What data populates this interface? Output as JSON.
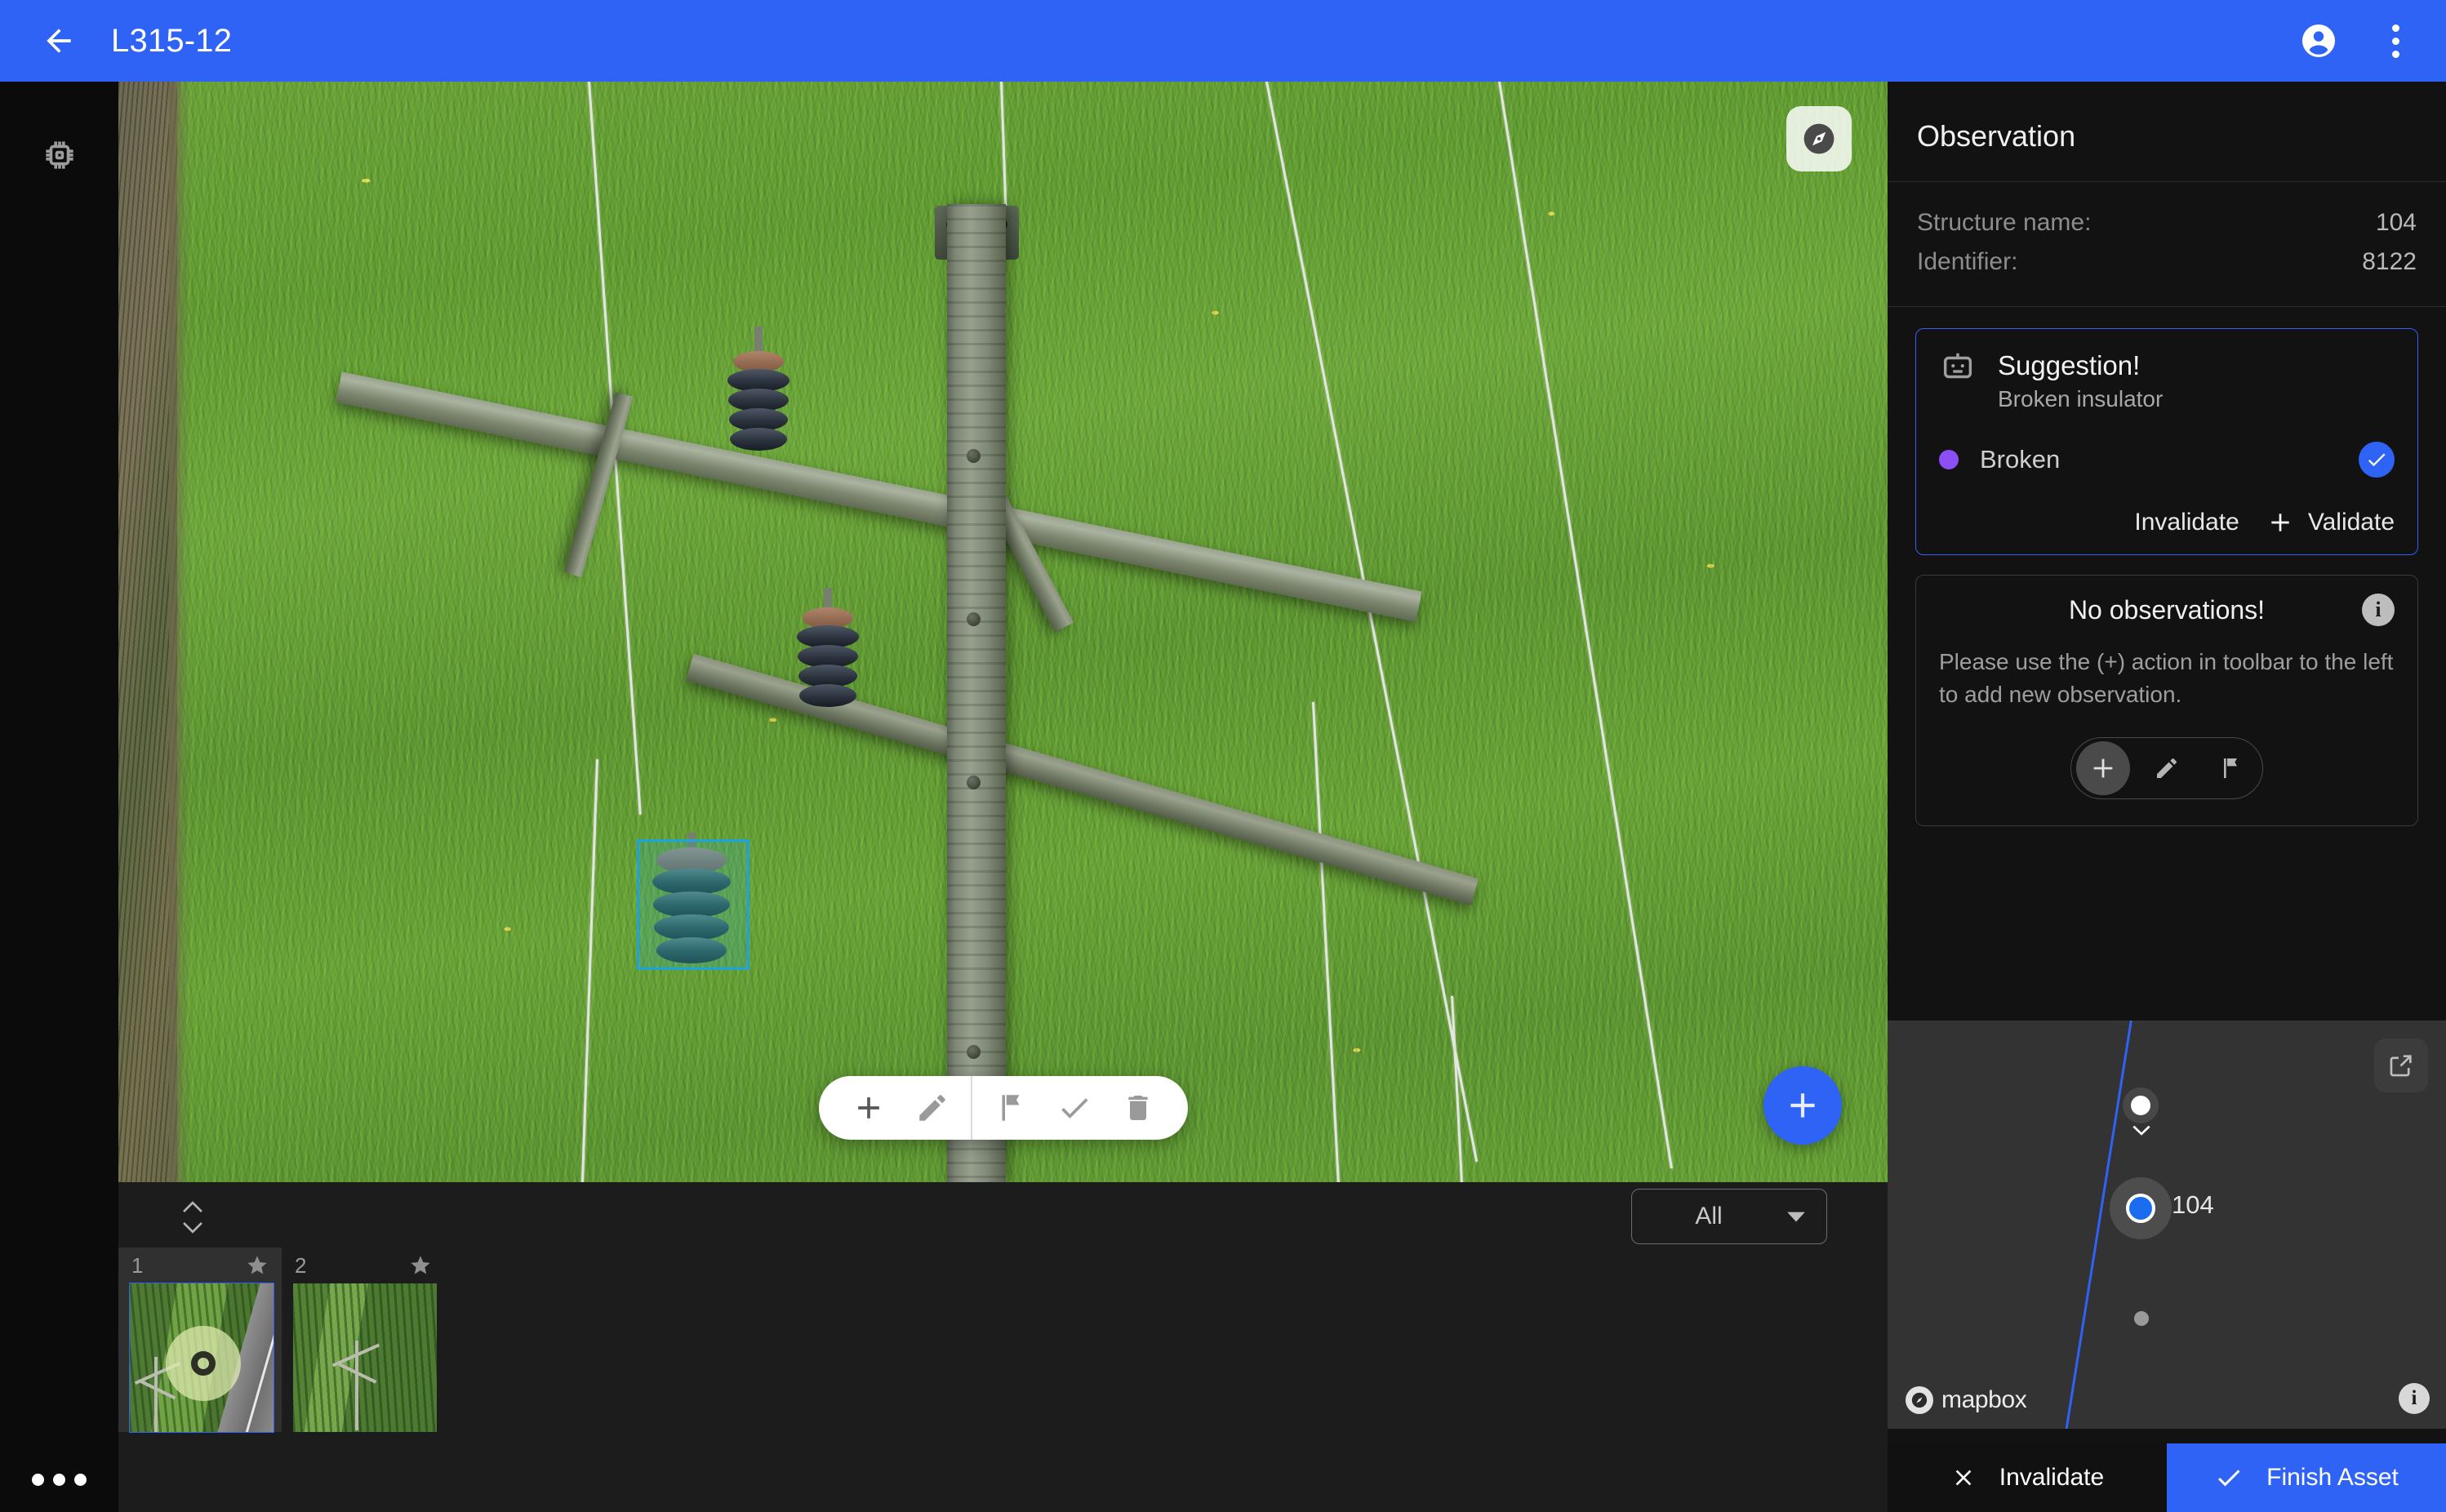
{
  "header": {
    "title": "L315-12",
    "back_icon": "arrow-back-icon",
    "account_icon": "account-circle-icon",
    "overflow_icon": "more-vert-icon"
  },
  "left_rail": {
    "chip_icon": "chip-icon",
    "more_icon": "more-horiz-icon"
  },
  "viewer": {
    "compass_icon": "explore-compass-icon",
    "bbox_color": "#1fa3dd",
    "fab": {
      "label": "+",
      "icon": "plus-icon",
      "color": "#2f63f5"
    },
    "toolbar": [
      {
        "name": "add",
        "icon": "plus-icon"
      },
      {
        "name": "edit",
        "icon": "pencil-icon"
      },
      {
        "name": "flag",
        "icon": "flag-icon"
      },
      {
        "name": "approve",
        "icon": "check-icon"
      },
      {
        "name": "delete",
        "icon": "trash-icon"
      }
    ]
  },
  "filmstrip": {
    "sort_icon": "sort-updown-icon",
    "filter": {
      "value": "All",
      "caret_icon": "chevron-down-icon"
    },
    "thumbs": [
      {
        "index": "1",
        "star_icon": "star-icon",
        "selected": true
      },
      {
        "index": "2",
        "star_icon": "star-icon",
        "selected": false
      }
    ]
  },
  "panel": {
    "title": "Observation",
    "meta": [
      {
        "key": "Structure name:",
        "value": "104"
      },
      {
        "key": "Identifier:",
        "value": "8122"
      }
    ],
    "suggestion": {
      "robot_icon": "robot-icon",
      "title": "Suggestion!",
      "subtitle": "Broken insulator",
      "dot_color": "#8b4ff5",
      "label": "Broken",
      "check_icon": "check-circle-icon",
      "invalidate_label": "Invalidate",
      "validate_label": "Validate",
      "validate_icon": "plus-icon"
    },
    "no_observations": {
      "title": "No observations!",
      "info_icon": "info-icon",
      "info_char": "i",
      "body": "Please use the (+) action in toolbar to the left to add new observation.",
      "actions": [
        {
          "name": "add",
          "icon": "plus-icon",
          "active": true
        },
        {
          "name": "edit",
          "icon": "pencil-icon",
          "active": false
        },
        {
          "name": "flag",
          "icon": "flag-icon",
          "active": false
        }
      ]
    }
  },
  "map": {
    "selected_node_label": "104",
    "expand_icon": "open-in-new-icon",
    "attribution": "mapbox",
    "info_char": "i",
    "info_icon": "info-icon",
    "chevron_icon": "chevron-down-icon",
    "line_color": "#2f63f5"
  },
  "bottom_actions": {
    "invalidate": {
      "label": "Invalidate",
      "icon": "close-x-icon"
    },
    "finish": {
      "label": "Finish Asset",
      "icon": "check-icon",
      "color": "#2f63f5"
    }
  }
}
